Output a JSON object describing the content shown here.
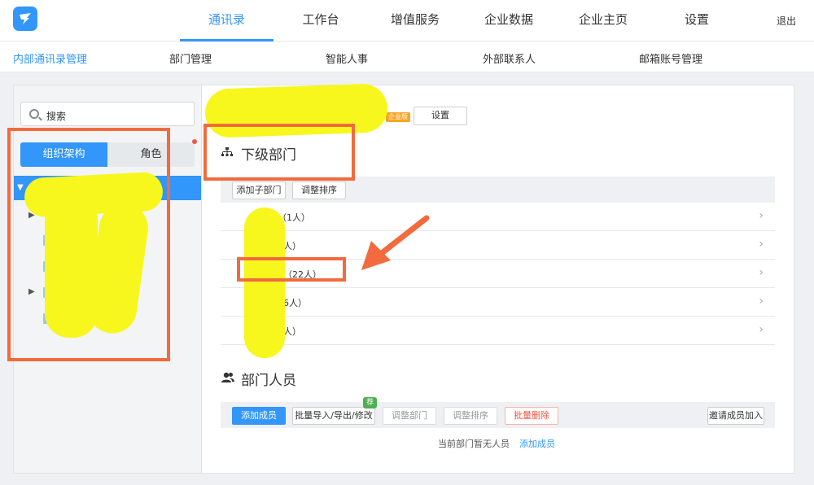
{
  "nav": {
    "items": [
      "通讯录",
      "工作台",
      "增值服务",
      "企业数据",
      "企业主页",
      "设置"
    ],
    "logout": "退出"
  },
  "subnav": {
    "items": [
      "内部通讯录管理",
      "部门管理",
      "智能人事",
      "外部联系人",
      "邮箱账号管理"
    ]
  },
  "sidebar": {
    "search_placeholder": "搜索",
    "tab_org": "组织架构",
    "tab_role": "角色"
  },
  "header": {
    "badge": "企业版",
    "settings_button": "设置"
  },
  "sub_departments": {
    "title": "下级部门",
    "add_button": "添加子部门",
    "sort_button": "调整排序",
    "rows": [
      "（1人）",
      "5人）",
      "目（22人）",
      "56人）",
      "3人）"
    ]
  },
  "members": {
    "title": "部门人员",
    "add_button": "添加成员",
    "batch_button": "批量导入/导出/修改",
    "batch_badge": "荐",
    "adjust_dept_button": "调整部门",
    "sort_button": "调整排序",
    "delete_button": "批量删除",
    "invite_button": "邀请成员加入",
    "empty_text": "当前部门暂无人员",
    "empty_link": "添加成员"
  },
  "colors": {
    "accent": "#3296fa",
    "annotation_orange": "#f26a3d",
    "highlighter_yellow": "#f7f71d"
  }
}
